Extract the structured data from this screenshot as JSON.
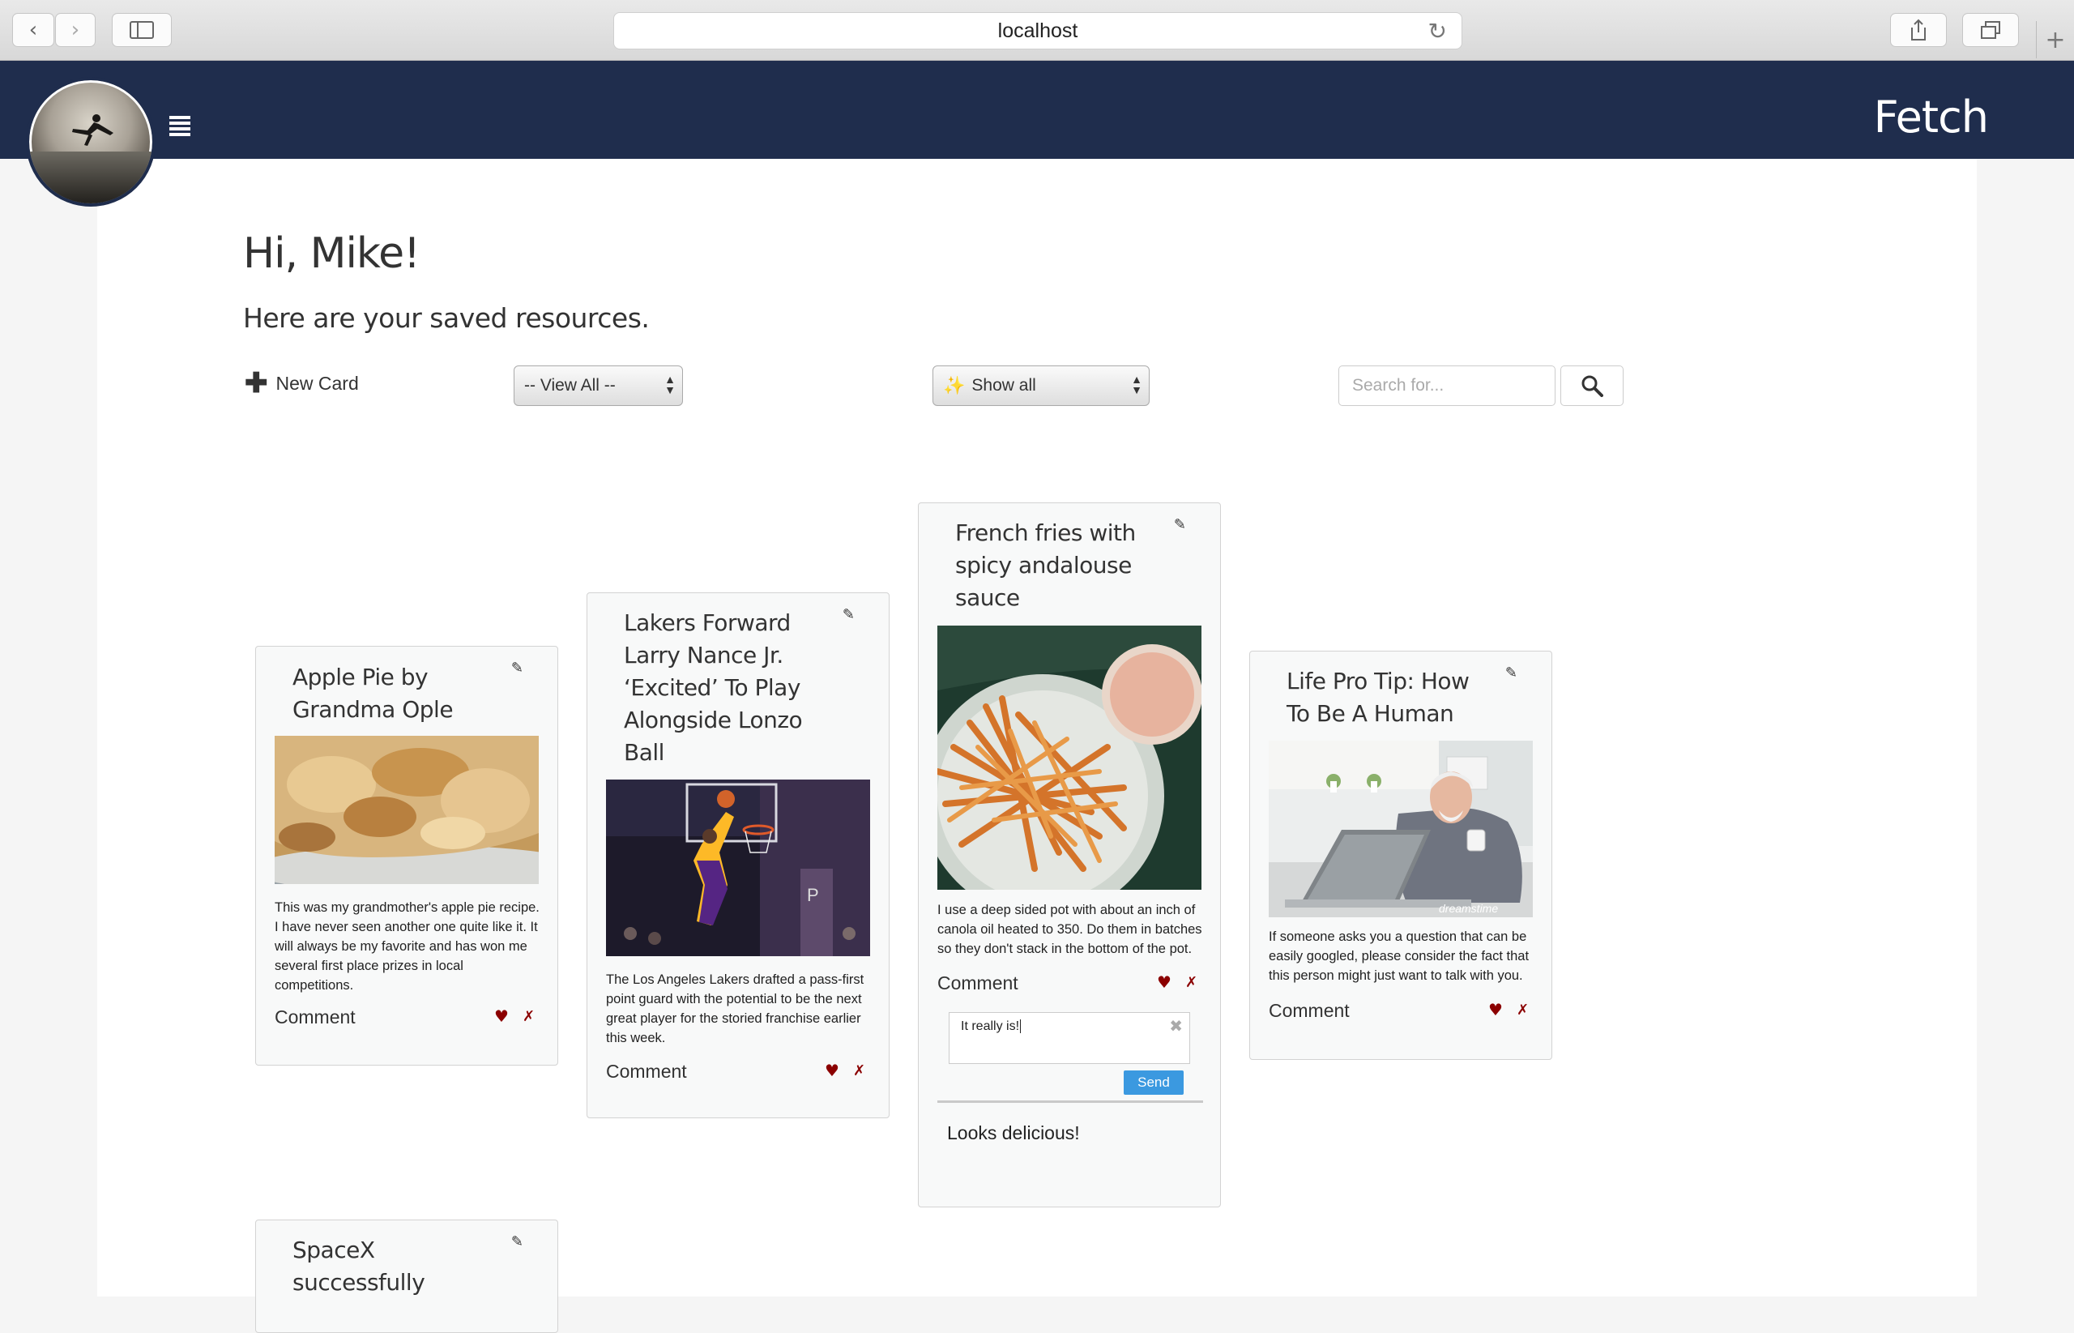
{
  "browser": {
    "url": "localhost",
    "back": "‹",
    "forward": "›",
    "reload": "↻",
    "new_tab": "+"
  },
  "header": {
    "brand": "Fetch"
  },
  "page": {
    "greeting": "Hi, Mike!",
    "subtitle": "Here are your saved resources."
  },
  "toolbar": {
    "new_card": "New Card",
    "view_select": "-- View All --",
    "show_select": "Show all",
    "search_placeholder": "Search for..."
  },
  "cards": [
    {
      "title": "Apple Pie by Grandma Ople",
      "image": "apple-pie-photo",
      "desc": "This was my grandmother's apple pie recipe. I have never seen another one quite like it. It will always be my favorite and has won me several first place prizes in local competitions.",
      "comment_label": "Comment"
    },
    {
      "title": "Lakers Forward Larry Nance Jr. ‘Excited’ To Play Alongside Lonzo Ball",
      "image": "basketball-dunk-photo",
      "desc": "The Los Angeles Lakers drafted a pass-first point guard with the potential to be the next great player for the storied franchise earlier this week.",
      "comment_label": "Comment"
    },
    {
      "title": "French fries with spicy andalouse sauce",
      "image": "french-fries-photo",
      "desc": "I use a deep sided pot with about an inch of canola oil heated to 350. Do them in batches so they don't stack in the bottom of the pot.",
      "comment_label": "Comment",
      "comment_input": "It really is!",
      "send_label": "Send",
      "comments": [
        "Looks delicious!"
      ]
    },
    {
      "title": "Life Pro Tip: How To Be A Human",
      "image": "man-with-laptop-photo",
      "watermark": "dreamstime",
      "desc": "If someone asks you a question that can be easily googled, please consider the fact that this person might just want to talk with you.",
      "comment_label": "Comment"
    },
    {
      "title": "SpaceX successfully"
    }
  ],
  "icons": {
    "edit": "✎",
    "heart": "♥",
    "delete": "✗",
    "clear": "✖",
    "plus": "✚"
  },
  "colors": {
    "navbar": "#1f2d4d",
    "heart": "#8b0000",
    "send": "#3b99e0"
  }
}
